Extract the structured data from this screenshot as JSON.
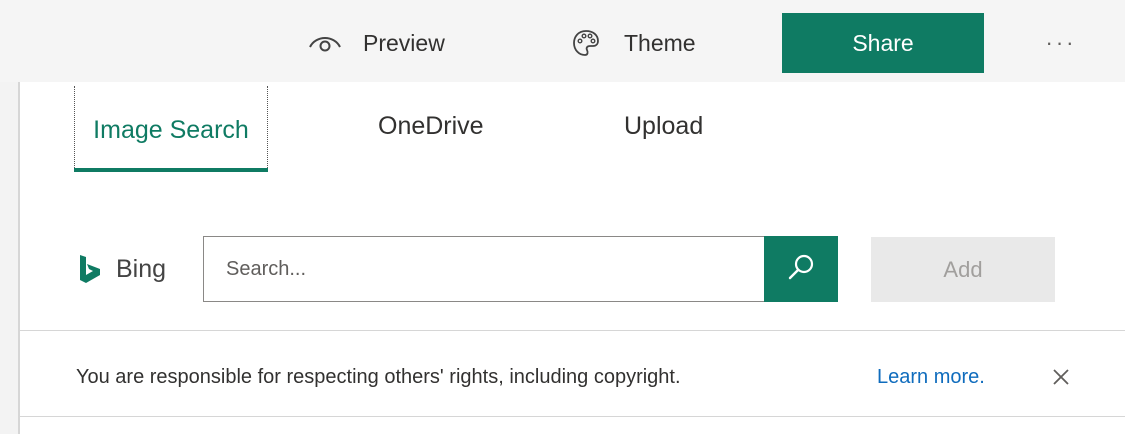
{
  "toolbar": {
    "preview_label": "Preview",
    "preview_icon": "eye-icon",
    "theme_label": "Theme",
    "theme_icon": "palette-icon",
    "share_label": "Share",
    "more_label": "···",
    "more_icon": "more-options-icon"
  },
  "tabs": [
    {
      "label": "Image Search",
      "selected": true
    },
    {
      "label": "OneDrive",
      "selected": false
    },
    {
      "label": "Upload",
      "selected": false
    }
  ],
  "search": {
    "provider_label": "Bing",
    "provider_icon": "bing-logo-icon",
    "placeholder": "Search...",
    "value": "",
    "search_icon": "search-icon",
    "add_label": "Add",
    "add_enabled": false
  },
  "notice": {
    "text": "You are responsible for respecting others' rights, including copyright.",
    "link_label": "Learn more.",
    "close_icon": "close-icon"
  },
  "colors": {
    "accent": "#0f7b63",
    "link": "#0f6cbd",
    "disabled_bg": "#e9e9e9"
  }
}
